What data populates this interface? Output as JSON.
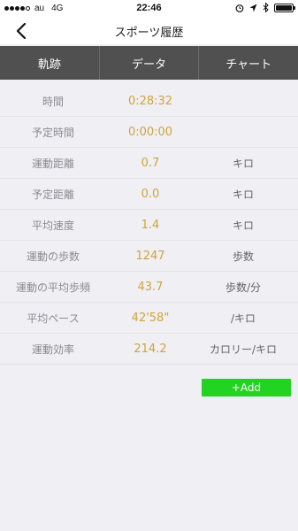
{
  "status_bar": {
    "carrier": "au",
    "network": "4G",
    "time": "22:46",
    "icons": [
      "alarm-icon",
      "location-icon",
      "bluetooth-icon",
      "battery-icon"
    ]
  },
  "header": {
    "title": "スポーツ履歴",
    "back_icon": "chevron-left-icon"
  },
  "tabs": [
    {
      "label": "軌跡"
    },
    {
      "label": "データ"
    },
    {
      "label": "チャート"
    }
  ],
  "rows": [
    {
      "label": "時間",
      "value": "0:28:32",
      "unit": ""
    },
    {
      "label": "予定時間",
      "value": "0:00:00",
      "unit": ""
    },
    {
      "label": "運動距離",
      "value": "0.7",
      "unit": "キロ"
    },
    {
      "label": "予定距離",
      "value": "0.0",
      "unit": "キロ"
    },
    {
      "label": "平均速度",
      "value": "1.4",
      "unit": "キロ"
    },
    {
      "label": "運動の歩数",
      "value": "1247",
      "unit": "歩数"
    },
    {
      "label": "運動の平均歩頻",
      "value": "43.7",
      "unit": "歩数/分"
    },
    {
      "label": "平均ペース",
      "value": "42'58\"",
      "unit": "/キロ"
    },
    {
      "label": "運動効率",
      "value": "214.2",
      "unit": "カロリー/キロ"
    }
  ],
  "add_button": {
    "label": "+Add"
  },
  "colors": {
    "accent_value": "#cfa53b",
    "tab_background": "#505050",
    "add_button": "#22d322",
    "page_background": "#efeff4"
  }
}
